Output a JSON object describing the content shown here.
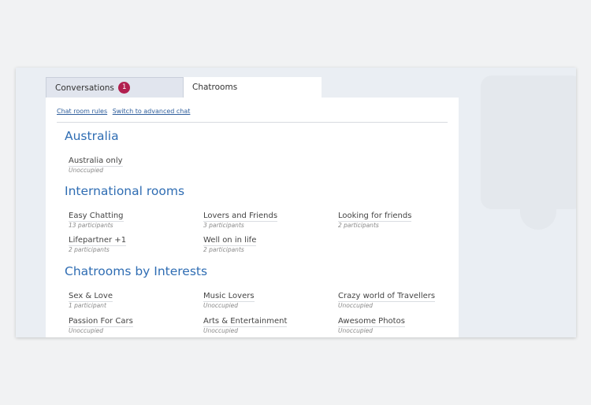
{
  "tabs": {
    "conversations_label": "Conversations",
    "conversations_badge": "1",
    "chatrooms_label": "Chatrooms"
  },
  "links": {
    "rules": "Chat room rules",
    "advanced": "Switch to advanced chat"
  },
  "sections": {
    "australia": {
      "title": "Australia",
      "rooms": [
        {
          "name": "Australia only",
          "status": "Unoccupied"
        }
      ]
    },
    "international": {
      "title": "International rooms",
      "rooms": [
        {
          "name": "Easy Chatting",
          "status": "13 participants"
        },
        {
          "name": "Lovers and Friends",
          "status": "3 participants"
        },
        {
          "name": "Looking for friends",
          "status": "2 participants"
        },
        {
          "name": "Lifepartner +1",
          "status": "2 participants"
        },
        {
          "name": "Well on in life",
          "status": "2 participants"
        }
      ]
    },
    "interests": {
      "title": "Chatrooms by Interests",
      "rooms": [
        {
          "name": "Sex & Love",
          "status": "1 participant"
        },
        {
          "name": "Music Lovers",
          "status": "Unoccupied"
        },
        {
          "name": "Crazy world of Travellers",
          "status": "Unoccupied"
        },
        {
          "name": "Passion For Cars",
          "status": "Unoccupied"
        },
        {
          "name": "Arts & Entertainment",
          "status": "Unoccupied"
        },
        {
          "name": "Awesome Photos",
          "status": "Unoccupied"
        }
      ]
    }
  },
  "colors": {
    "accent": "#2f6db3",
    "badge": "#b11f4f",
    "link": "#2f5e9c"
  }
}
